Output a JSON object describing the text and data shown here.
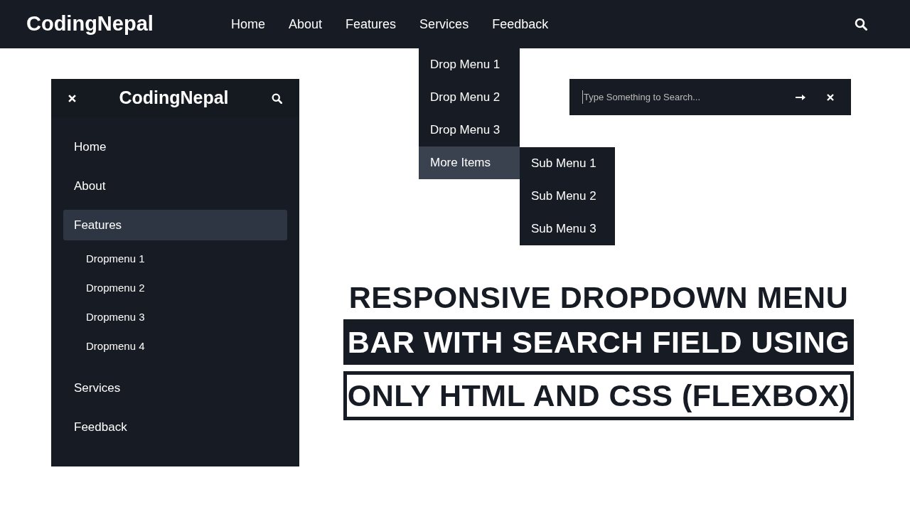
{
  "navbar": {
    "logo": "CodingNepal",
    "links": [
      "Home",
      "About",
      "Features",
      "Services",
      "Feedback"
    ]
  },
  "dropdown": {
    "items": [
      {
        "label": "Drop Menu 1",
        "selected": false
      },
      {
        "label": "Drop Menu 2",
        "selected": false
      },
      {
        "label": "Drop Menu 3",
        "selected": false
      },
      {
        "label": "More Items",
        "selected": true
      }
    ],
    "submenu": [
      "Sub Menu 1",
      "Sub Menu 2",
      "Sub Menu 3"
    ]
  },
  "search": {
    "placeholder": "Type Something to Search..."
  },
  "mobile_menu": {
    "logo": "CodingNepal",
    "items": [
      {
        "label": "Home",
        "selected": false
      },
      {
        "label": "About",
        "selected": false
      },
      {
        "label": "Features",
        "selected": true,
        "children": [
          "Dropmenu 1",
          "Dropmenu 2",
          "Dropmenu 3",
          "Dropmenu 4"
        ]
      },
      {
        "label": "Services",
        "selected": false
      },
      {
        "label": "Feedback",
        "selected": false
      }
    ]
  },
  "headline": [
    "RESPONSIVE DROPDOWN MENU",
    "BAR WITH SEARCH FIELD USING",
    "ONLY HTML AND CSS (FLEXBOX)"
  ]
}
